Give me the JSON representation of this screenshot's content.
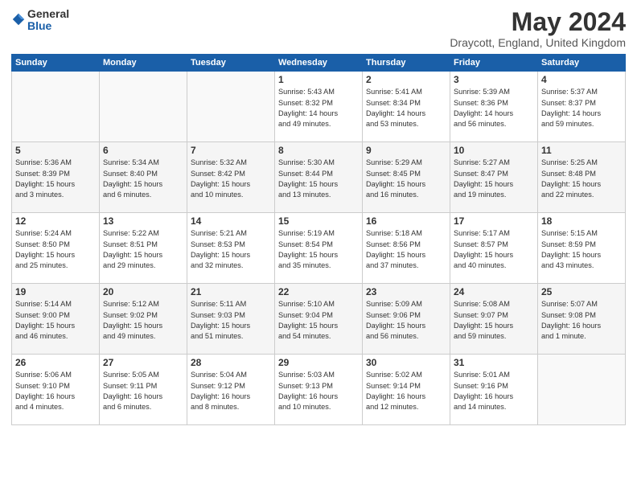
{
  "header": {
    "logo_general": "General",
    "logo_blue": "Blue",
    "title": "May 2024",
    "subtitle": "Draycott, England, United Kingdom"
  },
  "days_of_week": [
    "Sunday",
    "Monday",
    "Tuesday",
    "Wednesday",
    "Thursday",
    "Friday",
    "Saturday"
  ],
  "weeks": [
    [
      {
        "num": "",
        "info": ""
      },
      {
        "num": "",
        "info": ""
      },
      {
        "num": "",
        "info": ""
      },
      {
        "num": "1",
        "info": "Sunrise: 5:43 AM\nSunset: 8:32 PM\nDaylight: 14 hours\nand 49 minutes."
      },
      {
        "num": "2",
        "info": "Sunrise: 5:41 AM\nSunset: 8:34 PM\nDaylight: 14 hours\nand 53 minutes."
      },
      {
        "num": "3",
        "info": "Sunrise: 5:39 AM\nSunset: 8:36 PM\nDaylight: 14 hours\nand 56 minutes."
      },
      {
        "num": "4",
        "info": "Sunrise: 5:37 AM\nSunset: 8:37 PM\nDaylight: 14 hours\nand 59 minutes."
      }
    ],
    [
      {
        "num": "5",
        "info": "Sunrise: 5:36 AM\nSunset: 8:39 PM\nDaylight: 15 hours\nand 3 minutes."
      },
      {
        "num": "6",
        "info": "Sunrise: 5:34 AM\nSunset: 8:40 PM\nDaylight: 15 hours\nand 6 minutes."
      },
      {
        "num": "7",
        "info": "Sunrise: 5:32 AM\nSunset: 8:42 PM\nDaylight: 15 hours\nand 10 minutes."
      },
      {
        "num": "8",
        "info": "Sunrise: 5:30 AM\nSunset: 8:44 PM\nDaylight: 15 hours\nand 13 minutes."
      },
      {
        "num": "9",
        "info": "Sunrise: 5:29 AM\nSunset: 8:45 PM\nDaylight: 15 hours\nand 16 minutes."
      },
      {
        "num": "10",
        "info": "Sunrise: 5:27 AM\nSunset: 8:47 PM\nDaylight: 15 hours\nand 19 minutes."
      },
      {
        "num": "11",
        "info": "Sunrise: 5:25 AM\nSunset: 8:48 PM\nDaylight: 15 hours\nand 22 minutes."
      }
    ],
    [
      {
        "num": "12",
        "info": "Sunrise: 5:24 AM\nSunset: 8:50 PM\nDaylight: 15 hours\nand 25 minutes."
      },
      {
        "num": "13",
        "info": "Sunrise: 5:22 AM\nSunset: 8:51 PM\nDaylight: 15 hours\nand 29 minutes."
      },
      {
        "num": "14",
        "info": "Sunrise: 5:21 AM\nSunset: 8:53 PM\nDaylight: 15 hours\nand 32 minutes."
      },
      {
        "num": "15",
        "info": "Sunrise: 5:19 AM\nSunset: 8:54 PM\nDaylight: 15 hours\nand 35 minutes."
      },
      {
        "num": "16",
        "info": "Sunrise: 5:18 AM\nSunset: 8:56 PM\nDaylight: 15 hours\nand 37 minutes."
      },
      {
        "num": "17",
        "info": "Sunrise: 5:17 AM\nSunset: 8:57 PM\nDaylight: 15 hours\nand 40 minutes."
      },
      {
        "num": "18",
        "info": "Sunrise: 5:15 AM\nSunset: 8:59 PM\nDaylight: 15 hours\nand 43 minutes."
      }
    ],
    [
      {
        "num": "19",
        "info": "Sunrise: 5:14 AM\nSunset: 9:00 PM\nDaylight: 15 hours\nand 46 minutes."
      },
      {
        "num": "20",
        "info": "Sunrise: 5:12 AM\nSunset: 9:02 PM\nDaylight: 15 hours\nand 49 minutes."
      },
      {
        "num": "21",
        "info": "Sunrise: 5:11 AM\nSunset: 9:03 PM\nDaylight: 15 hours\nand 51 minutes."
      },
      {
        "num": "22",
        "info": "Sunrise: 5:10 AM\nSunset: 9:04 PM\nDaylight: 15 hours\nand 54 minutes."
      },
      {
        "num": "23",
        "info": "Sunrise: 5:09 AM\nSunset: 9:06 PM\nDaylight: 15 hours\nand 56 minutes."
      },
      {
        "num": "24",
        "info": "Sunrise: 5:08 AM\nSunset: 9:07 PM\nDaylight: 15 hours\nand 59 minutes."
      },
      {
        "num": "25",
        "info": "Sunrise: 5:07 AM\nSunset: 9:08 PM\nDaylight: 16 hours\nand 1 minute."
      }
    ],
    [
      {
        "num": "26",
        "info": "Sunrise: 5:06 AM\nSunset: 9:10 PM\nDaylight: 16 hours\nand 4 minutes."
      },
      {
        "num": "27",
        "info": "Sunrise: 5:05 AM\nSunset: 9:11 PM\nDaylight: 16 hours\nand 6 minutes."
      },
      {
        "num": "28",
        "info": "Sunrise: 5:04 AM\nSunset: 9:12 PM\nDaylight: 16 hours\nand 8 minutes."
      },
      {
        "num": "29",
        "info": "Sunrise: 5:03 AM\nSunset: 9:13 PM\nDaylight: 16 hours\nand 10 minutes."
      },
      {
        "num": "30",
        "info": "Sunrise: 5:02 AM\nSunset: 9:14 PM\nDaylight: 16 hours\nand 12 minutes."
      },
      {
        "num": "31",
        "info": "Sunrise: 5:01 AM\nSunset: 9:16 PM\nDaylight: 16 hours\nand 14 minutes."
      },
      {
        "num": "",
        "info": ""
      }
    ]
  ]
}
